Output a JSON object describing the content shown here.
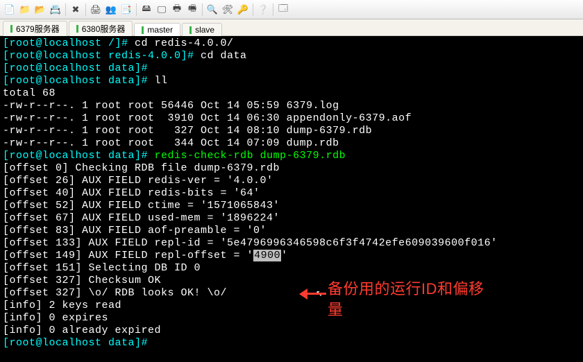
{
  "tabs": [
    {
      "label": "6379服务器",
      "active": false
    },
    {
      "label": "6380服务器",
      "active": false
    },
    {
      "label": "master",
      "active": true
    },
    {
      "label": "slave",
      "active": false
    }
  ],
  "annotation": {
    "line1": "备份用的运行ID和偏移",
    "line2": "量"
  },
  "term": {
    "l1_prompt": "[root@localhost /]# ",
    "l1_cmd": "cd redis-4.0.0/",
    "l2_prompt": "[root@localhost redis-4.0.0]# ",
    "l2_cmd": "cd data",
    "l3_prompt": "[root@localhost data]#",
    "l4_prompt": "[root@localhost data]# ",
    "l4_cmd": "ll",
    "l5": "total 68",
    "l6": "-rw-r--r--. 1 root root 56446 Oct 14 05:59 6379.log",
    "l7": "-rw-r--r--. 1 root root  3910 Oct 14 06:30 appendonly-6379.aof",
    "l8": "-rw-r--r--. 1 root root   327 Oct 14 08:10 dump-6379.rdb",
    "l9": "-rw-r--r--. 1 root root   344 Oct 14 07:09 dump.rdb",
    "l10_prompt": "[root@localhost data]# ",
    "l10_cmd": "redis-check-rdb dump-6379.rdb",
    "l11": "[offset 0] Checking RDB file dump-6379.rdb",
    "l12": "[offset 26] AUX FIELD redis-ver = '4.0.0'",
    "l13": "[offset 40] AUX FIELD redis-bits = '64'",
    "l14": "[offset 52] AUX FIELD ctime = '1571065843'",
    "l15": "[offset 67] AUX FIELD used-mem = '1896224'",
    "l16": "[offset 83] AUX FIELD aof-preamble = '0'",
    "l17": "[offset 133] AUX FIELD repl-id = '5e4796996346598c6f3f4742efe609039600f016'",
    "l18a": "[offset 149] AUX FIELD repl-offset = '",
    "l18sel": "4900",
    "l18b": "'",
    "l19": "[offset 151] Selecting DB ID 0",
    "l20": "[offset 327] Checksum OK",
    "l21": "[offset 327] \\o/ RDB looks OK! \\o/",
    "l22": "[info] 2 keys read",
    "l23": "[info] 0 expires",
    "l24": "[info] 0 already expired",
    "l25_prompt": "[root@localhost data]#"
  }
}
